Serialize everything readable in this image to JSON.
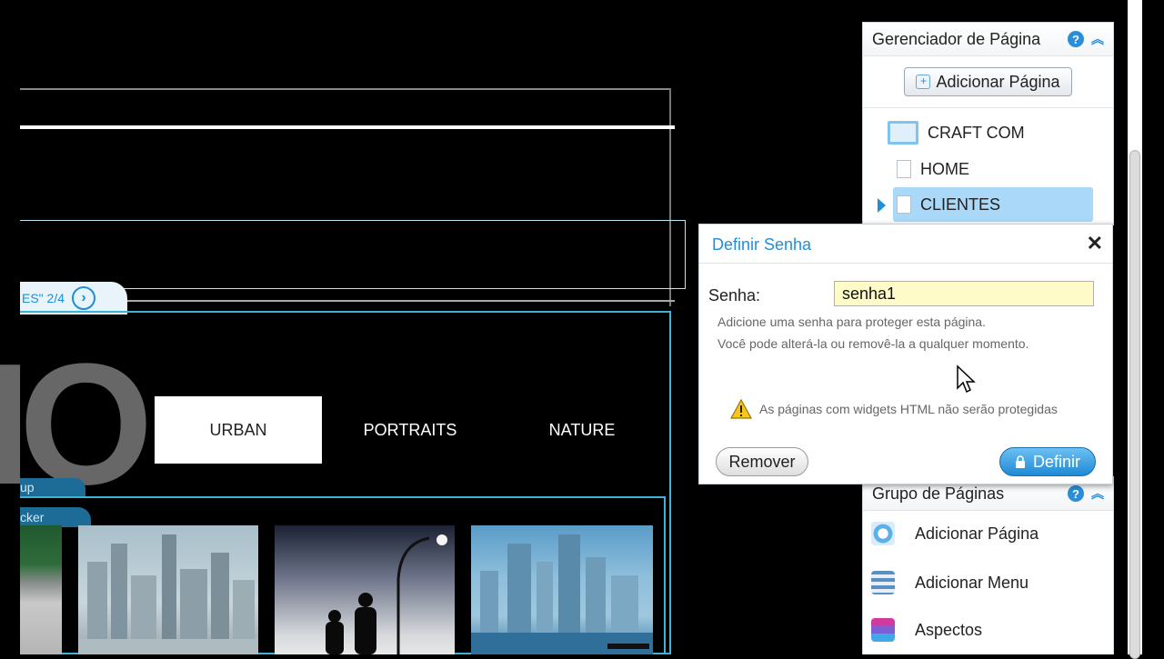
{
  "canvas": {
    "tab_label": "ES\" 2/4",
    "logo_text": "IO",
    "nav": [
      "URBAN",
      "PORTRAITS",
      "NATURE"
    ],
    "side_tab_1": "up",
    "side_tab_2": "cker"
  },
  "page_manager": {
    "title": "Gerenciador de Página",
    "add_page_button": "Adicionar Página",
    "site_name": "CRAFT COM",
    "pages": [
      "HOME",
      "CLIENTES"
    ]
  },
  "dialog": {
    "title": "Definir Senha",
    "close": "✕",
    "password_label": "Senha:",
    "password_value": "senha1",
    "hint_line1": "Adicione uma senha para proteger esta página.",
    "hint_line2": "Você pode alterá-la ou removê-la a qualquer momento.",
    "warning": "As páginas com widgets HTML não serão protegidas",
    "remove_button": "Remover",
    "define_button": "Definir"
  },
  "page_group": {
    "title": "Grupo de Páginas",
    "items": [
      "Adicionar Página",
      "Adicionar Menu",
      "Aspectos"
    ]
  },
  "colors": {
    "accent": "#1e90d8",
    "selected_row": "#a9d8f8",
    "input_bg": "#fffbc8",
    "canvas_cyan": "#3fb2d6"
  }
}
